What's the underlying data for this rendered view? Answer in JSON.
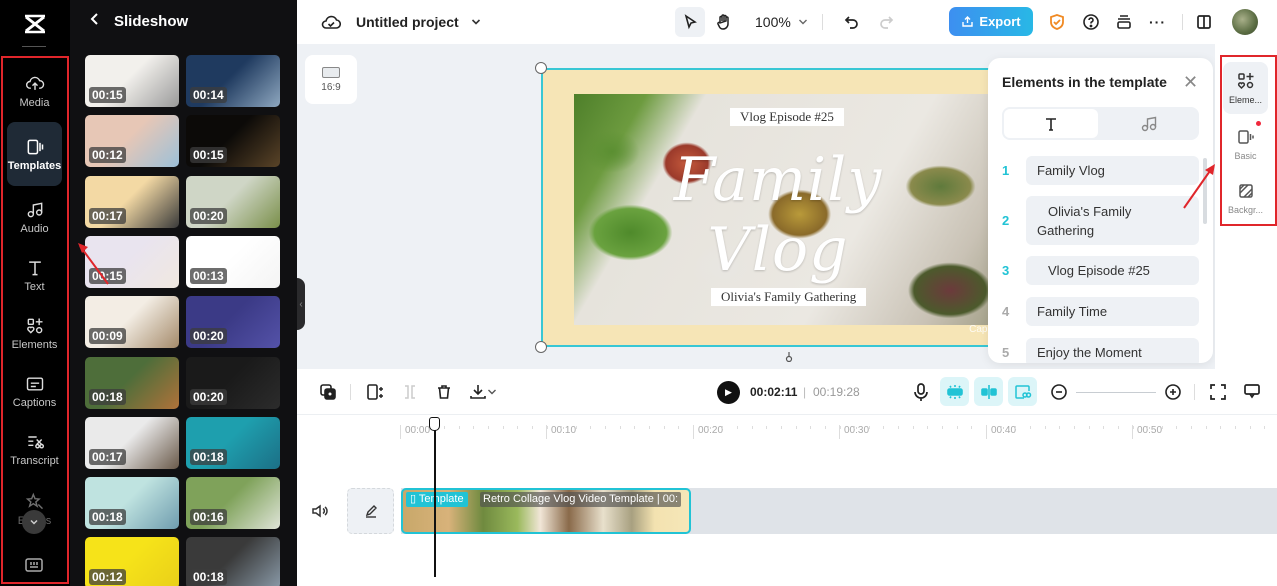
{
  "app": {
    "logo": "capcut-logo"
  },
  "rail": {
    "items": [
      {
        "label": "Media",
        "icon": "cloud-upload-icon"
      },
      {
        "label": "Templates",
        "icon": "templates-icon",
        "active": true
      },
      {
        "label": "Audio",
        "icon": "music-note-icon"
      },
      {
        "label": "Text",
        "icon": "text-icon"
      },
      {
        "label": "Elements",
        "icon": "elements-icon"
      },
      {
        "label": "Captions",
        "icon": "captions-icon"
      },
      {
        "label": "Transcript",
        "icon": "transcript-icon"
      },
      {
        "label": "Effects",
        "icon": "effects-star-icon"
      }
    ],
    "more_icon": "chevron-down-icon",
    "bottom_icon": "keyboard-shortcuts-icon"
  },
  "panel": {
    "back_icon": "chevron-left-icon",
    "title": "Slideshow",
    "templates": [
      {
        "duration": "00:15",
        "colors": [
          "#f2f0ec",
          "#9a9a9a"
        ]
      },
      {
        "duration": "00:14",
        "colors": [
          "#1f3a5f",
          "#8ea7bf"
        ]
      },
      {
        "duration": "00:12",
        "colors": [
          "#e7c7b6",
          "#9cc0d8"
        ]
      },
      {
        "duration": "00:15",
        "colors": [
          "#0c0a08",
          "#5a4428"
        ]
      },
      {
        "duration": "00:17",
        "colors": [
          "#f3d9a4",
          "#3a3a3a"
        ]
      },
      {
        "duration": "00:20",
        "colors": [
          "#cfd6c6",
          "#7a8f4a"
        ]
      },
      {
        "duration": "00:15",
        "colors": [
          "#e9e4ef",
          "#f0e8e0"
        ]
      },
      {
        "duration": "00:13",
        "colors": [
          "#ffffff",
          "#f4f4f4"
        ]
      },
      {
        "duration": "00:09",
        "colors": [
          "#f3ede4",
          "#a48a6a"
        ]
      },
      {
        "duration": "00:20",
        "colors": [
          "#3b3a86",
          "#5452a8"
        ]
      },
      {
        "duration": "00:18",
        "colors": [
          "#4e6e3a",
          "#b0723a"
        ]
      },
      {
        "duration": "00:20",
        "colors": [
          "#1a1a1a",
          "#2c2c2c"
        ]
      },
      {
        "duration": "00:17",
        "colors": [
          "#eaeaea",
          "#6a5a4a"
        ]
      },
      {
        "duration": "00:18",
        "colors": [
          "#1e9fae",
          "#1c6f86"
        ]
      },
      {
        "duration": "00:18",
        "colors": [
          "#bfe3e0",
          "#6f9cae"
        ]
      },
      {
        "duration": "00:16",
        "colors": [
          "#7fa25a",
          "#dfe4d8"
        ]
      },
      {
        "duration": "00:12",
        "colors": [
          "#f6e319",
          "#e9cf19"
        ]
      },
      {
        "duration": "00:18",
        "colors": [
          "#3a3a3a",
          "#8a9aa8"
        ]
      }
    ],
    "collapse_icon": "chevron-left-icon"
  },
  "topbar": {
    "cloud_icon": "cloud-check-icon",
    "project_name": "Untitled project",
    "project_dropdown_icon": "chevron-down-icon",
    "pointer_icon": "pointer-icon",
    "hand_icon": "hand-icon",
    "zoom_level": "100%",
    "undo_icon": "undo-icon",
    "redo_icon": "redo-icon",
    "export_label": "Export",
    "export_icon": "upload-icon",
    "shield_icon": "shield-check-icon",
    "help_icon": "help-icon",
    "stack_icon": "stack-icon",
    "more_icon": "more-horizontal-icon",
    "layout_icon": "split-layout-icon",
    "accent": "#3d8ff0"
  },
  "canvas": {
    "ratio_label": "16:9",
    "episode_label": "Vlog Episode #25",
    "title_text": "Family Vlog",
    "subtitle_label": "Olivia's Family Gathering",
    "watermark": "CapCut",
    "selection_color": "#38c7d4"
  },
  "elements_popover": {
    "title": "Elements in the template",
    "close_icon": "close-icon",
    "tabs": [
      {
        "icon": "text-icon",
        "active": true
      },
      {
        "icon": "music-note-icon",
        "active": false
      }
    ],
    "items": [
      {
        "index": "1",
        "text": "Family Vlog",
        "highlight": true
      },
      {
        "index": "2",
        "text": "Olivia's Family Gathering",
        "highlight": true
      },
      {
        "index": "3",
        "text": "Vlog Episode #25",
        "highlight": true
      },
      {
        "index": "4",
        "text": "Family Time",
        "highlight": false
      },
      {
        "index": "5",
        "text": "Enjoy the Moment",
        "highlight": false
      }
    ]
  },
  "property_rail": {
    "items": [
      {
        "label": "Eleme...",
        "icon": "elements-icon",
        "active": true
      },
      {
        "label": "Basic",
        "icon": "basic-video-icon",
        "active": false,
        "badge": true
      },
      {
        "label": "Backgr...",
        "icon": "background-icon",
        "active": false
      }
    ]
  },
  "timeline": {
    "toolbar": {
      "layers_icon": "layers-icon",
      "split_icon": "split-icon",
      "trim_icon": "trim-icon",
      "delete_icon": "delete-icon",
      "download_icon": "download-icon",
      "download_dropdown_icon": "chevron-down-icon",
      "play_icon": "play-icon",
      "current_time": "00:02:11",
      "separator": "|",
      "total_time": "00:19:28",
      "mic_icon": "microphone-icon",
      "magnet_icon": "magnet-snap-icon",
      "link_icon": "split-align-icon",
      "preview_link_icon": "linked-preview-icon",
      "zoom_out_icon": "zoom-out-icon",
      "zoom_in_icon": "zoom-in-icon",
      "fit_icon": "fullscreen-icon",
      "comment_icon": "comment-icon"
    },
    "ruler": [
      "00:00",
      "00:10",
      "00:20",
      "00:30",
      "00:40",
      "00:50"
    ],
    "track": {
      "volume_icon": "volume-icon",
      "cover_icon": "edit-pencil-icon",
      "clip_tag": "Template",
      "clip_name": "Retro Collage Vlog Video Template | 00:"
    }
  }
}
